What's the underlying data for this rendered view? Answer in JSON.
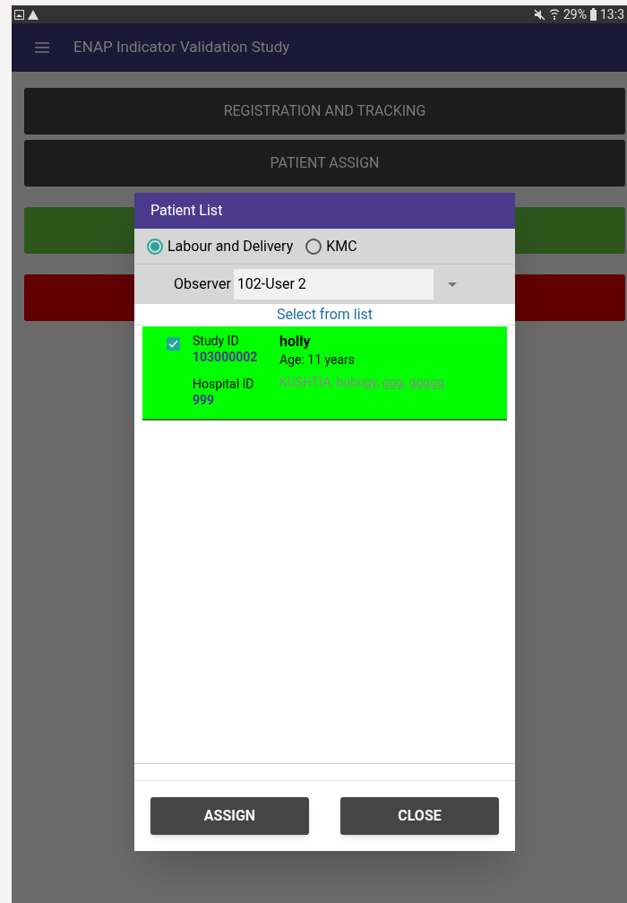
{
  "status_bar": {
    "battery": "29%",
    "time": "13:3"
  },
  "app_bar": {
    "title": "ENAP Indicator Validation Study"
  },
  "menu_buttons": [
    {
      "label": "REGISTRATION AND TRACKING",
      "color": "#1c1c1c"
    },
    {
      "label": "PATIENT ASSIGN",
      "color": "#1c1c1c"
    },
    {
      "color": "#2d561d"
    },
    {
      "color": "#620000"
    }
  ],
  "dialog": {
    "title": "Patient List",
    "radios": [
      {
        "label": "Labour and Delivery",
        "selected": true
      },
      {
        "label": "KMC",
        "selected": false
      }
    ],
    "observer": {
      "label": "Observer",
      "value": "102-User 2"
    },
    "list_hint": "Select from list",
    "patients": [
      {
        "checked": true,
        "study_id_label": "Study ID",
        "study_id": "103000002",
        "hospital_id_label": "Hospital ID",
        "hospital_id": "999",
        "name": "holly",
        "age": "Age: 11 years",
        "address": "KUSHTIA, bubugy, ggg, ggggg"
      }
    ],
    "buttons": [
      "ASSIGN",
      "CLOSE"
    ]
  }
}
